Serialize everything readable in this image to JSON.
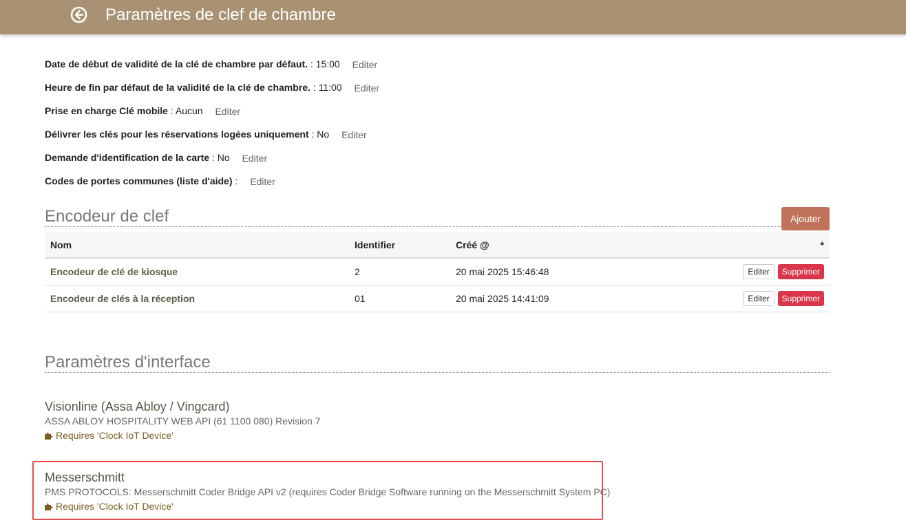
{
  "header": {
    "title": "Paramètres de clef de chambre",
    "back_icon": "circle-arrow-left-icon"
  },
  "settings": [
    {
      "label": "Date de début de validité de la clé de chambre par défaut.",
      "value": "15:00",
      "edit": "Editer"
    },
    {
      "label": "Heure de fin par défaut de la validité de la clé de chambre.",
      "value": "11:00",
      "edit": "Editer"
    },
    {
      "label": "Prise en charge Clé mobile",
      "value": "Aucun",
      "edit": "Editer"
    },
    {
      "label": "Délivrer les clés pour les réservations logées uniquement",
      "value": "No",
      "edit": "Editer"
    },
    {
      "label": "Demande d'identification de la carte",
      "value": "No",
      "edit": "Editer"
    },
    {
      "label": "Codes de portes communes (liste d'aide)",
      "value": "",
      "edit": "Editer"
    }
  ],
  "encoder": {
    "title": "Encodeur de clef",
    "add_label": "Ajouter",
    "columns": [
      "Nom",
      "Identifier",
      "Créé @",
      "*"
    ],
    "rows": [
      {
        "name": "Encodeur de clé de kiosque",
        "identifier": "2",
        "created": "20 mai 2025 15:46:48",
        "edit": "Editer",
        "delete": "Supprimer"
      },
      {
        "name": "Encodeur de clés à la réception",
        "identifier": "01",
        "created": "20 mai 2025 14:41:09",
        "edit": "Editer",
        "delete": "Supprimer"
      }
    ]
  },
  "interfaces": {
    "title": "Paramètres d'interface",
    "items": [
      {
        "name": "Visionline (Assa Abloy / Vingcard)",
        "description": "ASSA ABLOY HOSPITALITY WEB API (61 1100 080) Revision 7",
        "requires": "Requires 'Clock IoT Device'",
        "icon": "puzzle-icon"
      },
      {
        "name": "Messerschmitt",
        "description": "PMS PROTOCOLS: Messerschmitt Coder Bridge API v2 (requires Coder Bridge Software running on the Messerschmitt System PC)",
        "requires": "Requires 'Clock IoT Device'",
        "icon": "puzzle-icon"
      }
    ]
  },
  "colors": {
    "header_bg": "#a89273",
    "add_button": "#c0735a",
    "delete_button": "#d9364a",
    "highlight": "#e84c4c"
  }
}
